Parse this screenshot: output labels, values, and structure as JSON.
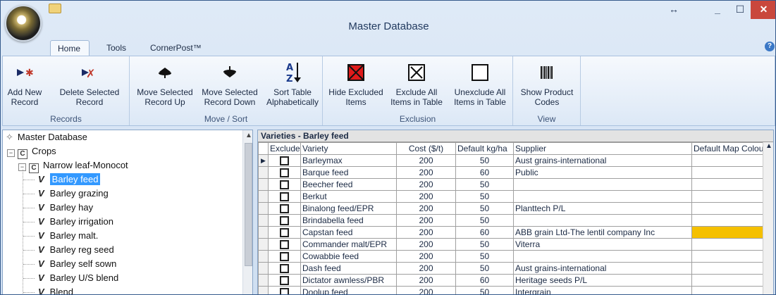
{
  "window": {
    "title": "Master Database",
    "resize_glyph": "↔",
    "min_glyph": "_",
    "max_glyph": "☐",
    "close_glyph": "✕"
  },
  "tabs": [
    {
      "label": "Home"
    },
    {
      "label": "Tools"
    },
    {
      "label": "CornerPost™"
    }
  ],
  "help_glyph": "?",
  "ribbon": {
    "groups": [
      {
        "label": "Records",
        "buttons": [
          {
            "label": "Add New\nRecord",
            "icon": "add-record-icon"
          },
          {
            "label": "Delete Selected\nRecord",
            "icon": "delete-record-icon"
          }
        ]
      },
      {
        "label": "Move / Sort",
        "buttons": [
          {
            "label": "Move Selected\nRecord Up",
            "icon": "move-up-icon"
          },
          {
            "label": "Move Selected\nRecord Down",
            "icon": "move-down-icon"
          },
          {
            "label": "Sort Table\nAlphabetically",
            "icon": "sort-az-icon",
            "glyph_top": "A",
            "glyph_bottom": "Z"
          }
        ]
      },
      {
        "label": "Exclusion",
        "buttons": [
          {
            "label": "Hide Excluded\nItems",
            "icon": "hide-excluded-icon"
          },
          {
            "label": "Exclude All\nItems in Table",
            "icon": "exclude-all-icon"
          },
          {
            "label": "Unexclude All\nItems in Table",
            "icon": "unexclude-all-icon"
          }
        ]
      },
      {
        "label": "View",
        "buttons": [
          {
            "label": "Show Product\nCodes",
            "icon": "barcode-icon"
          }
        ]
      }
    ]
  },
  "tree": {
    "root": "Master Database",
    "crops": {
      "label": "Crops",
      "box": "C"
    },
    "group": {
      "label": "Narrow leaf-Monocot",
      "box": "C"
    },
    "selected_index": 0,
    "items": [
      "Barley feed",
      "Barley grazing",
      "Barley hay",
      "Barley irrigation",
      "Barley malt.",
      "Barley reg seed",
      "Barley self sown",
      "Barley U/S blend",
      "Blend"
    ],
    "v_glyph": "V"
  },
  "grid": {
    "caption": "Varieties - Barley feed",
    "columns": [
      "Exclude",
      "Variety",
      "Cost ($/t)",
      "Default kg/ha",
      "Supplier",
      "Default Map Colou"
    ],
    "rows": [
      {
        "variety": "Barleymax",
        "cost": "200",
        "kg": "50",
        "supplier": "Aust grains-international",
        "color": ""
      },
      {
        "variety": "Barque feed",
        "cost": "200",
        "kg": "60",
        "supplier": "Public",
        "color": ""
      },
      {
        "variety": "Beecher feed",
        "cost": "200",
        "kg": "50",
        "supplier": "",
        "color": ""
      },
      {
        "variety": "Berkut",
        "cost": "200",
        "kg": "50",
        "supplier": "",
        "color": ""
      },
      {
        "variety": "Binalong feed/EPR",
        "cost": "200",
        "kg": "50",
        "supplier": "Planttech P/L",
        "color": ""
      },
      {
        "variety": "Brindabella feed",
        "cost": "200",
        "kg": "50",
        "supplier": "",
        "color": ""
      },
      {
        "variety": "Capstan feed",
        "cost": "200",
        "kg": "60",
        "supplier": "ABB grain Ltd-The lentil company Inc",
        "color": "#f5c000"
      },
      {
        "variety": "Commander malt/EPR",
        "cost": "200",
        "kg": "50",
        "supplier": "Viterra",
        "color": ""
      },
      {
        "variety": "Cowabbie feed",
        "cost": "200",
        "kg": "50",
        "supplier": "",
        "color": ""
      },
      {
        "variety": "Dash feed",
        "cost": "200",
        "kg": "50",
        "supplier": "Aust grains-international",
        "color": ""
      },
      {
        "variety": "Dictator awnless/PBR",
        "cost": "200",
        "kg": "60",
        "supplier": "Heritage seeds P/L",
        "color": ""
      },
      {
        "variety": "Doolup feed",
        "cost": "200",
        "kg": "50",
        "supplier": "Intergrain",
        "color": ""
      }
    ],
    "current_row": 0,
    "current_row_glyph": "▶"
  }
}
